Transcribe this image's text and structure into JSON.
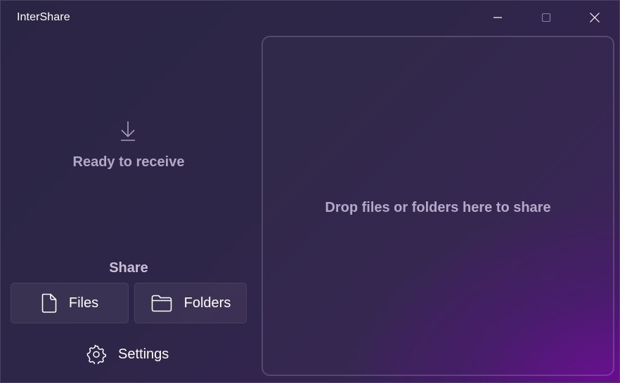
{
  "window": {
    "title": "InterShare"
  },
  "titlebar": {
    "buttons": [
      "minimize-icon",
      "maximize-icon",
      "close-icon"
    ]
  },
  "receive": {
    "icon": "download-icon",
    "status": "Ready to receive"
  },
  "share": {
    "heading": "Share",
    "files_label": "Files",
    "files_icon": "file-icon",
    "folders_label": "Folders",
    "folders_icon": "folder-icon"
  },
  "settings": {
    "label": "Settings",
    "icon": "gear-icon"
  },
  "drop_zone": {
    "text": "Drop files or folders here to share"
  },
  "colors": {
    "accent_purple": "#6a0a8e",
    "background": "#2b2545",
    "muted_text": "#b3a9c6"
  }
}
